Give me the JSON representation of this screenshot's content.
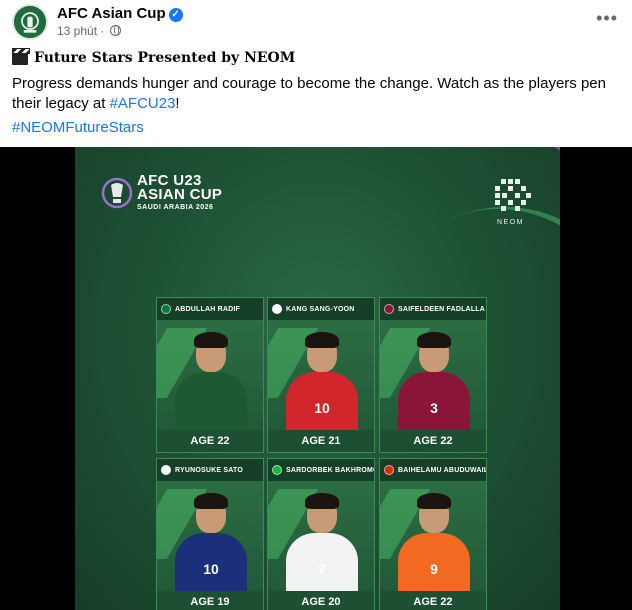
{
  "post": {
    "page_name": "AFC Asian Cup",
    "time": "13 phút",
    "headline": "Future Stars Presented by NEOM",
    "body": "Progress demands hunger and courage to become the change. Watch as the players pen their legacy at ",
    "body_hashtag": "#AFCU23",
    "body_end": "!",
    "hashtag2": "#NEOMFutureStars"
  },
  "poster": {
    "title_line1": "AFC U23",
    "title_line2": "ASIAN CUP",
    "subtitle": "SAUDI ARABIA 2026",
    "sponsor": "NEOM"
  },
  "players": [
    {
      "name": "ABDULLAH RADIF",
      "age": "AGE 22",
      "number": "",
      "flag_color": "#0a7a3a",
      "kit_color": "#1d5a33"
    },
    {
      "name": "KANG SANG-YOON",
      "age": "AGE 21",
      "number": "10",
      "flag_color": "#ffffff",
      "kit_color": "#d1262b"
    },
    {
      "name": "SAIFELDEEN FADLALLA",
      "age": "AGE 22",
      "number": "3",
      "flag_color": "#8a1538",
      "kit_color": "#8a1538"
    },
    {
      "name": "RYUNOSUKE SATO",
      "age": "AGE 19",
      "number": "10",
      "flag_color": "#ffffff",
      "kit_color": "#1b2f7a"
    },
    {
      "name": "SARDORBEK BAKHROMOV",
      "age": "AGE 20",
      "number": "7",
      "flag_color": "#1eb53a",
      "kit_color": "#f2f2f2"
    },
    {
      "name": "BAIHELAMU ABUDUWAILI",
      "age": "AGE 22",
      "number": "9",
      "flag_color": "#de2910",
      "kit_color": "#f26a21"
    }
  ]
}
